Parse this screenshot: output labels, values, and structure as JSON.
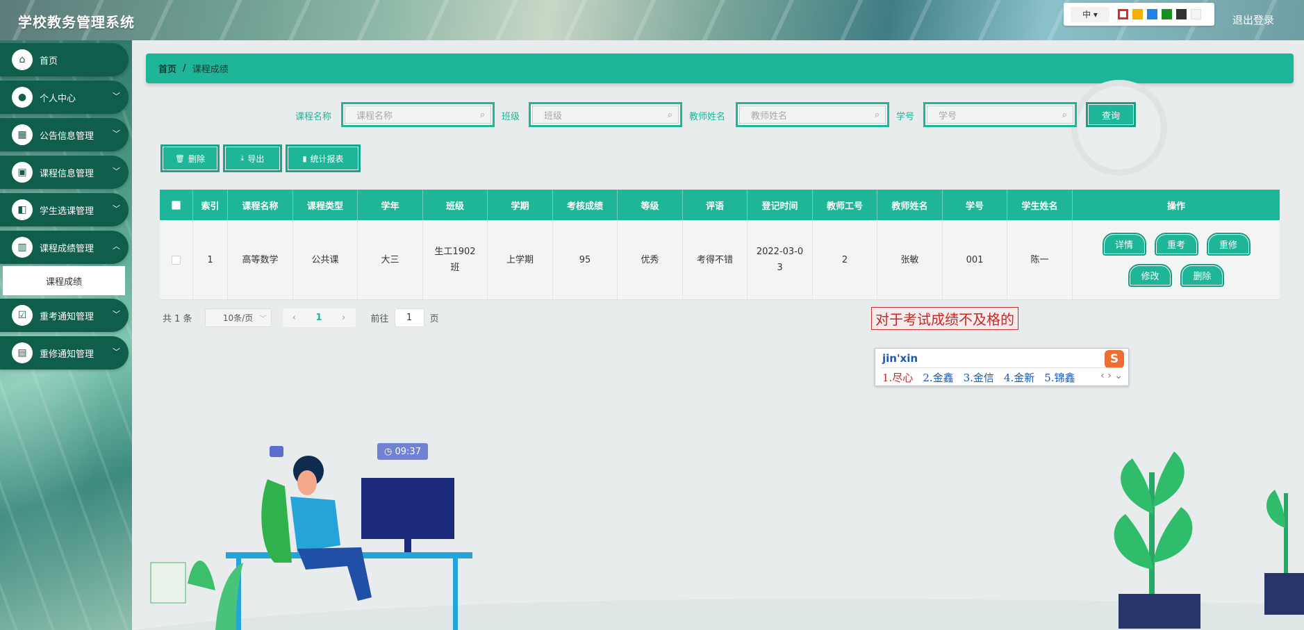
{
  "header": {
    "app_title": "学校教务管理系统",
    "lang": "中",
    "logout": "退出登录",
    "theme_colors": [
      "#e8261f",
      "#f2b100",
      "#1c86e8",
      "#17911d",
      "#333333",
      "#f4f4f4"
    ]
  },
  "sidebar": {
    "items": [
      {
        "label": "首页",
        "icon": "home-icon"
      },
      {
        "label": "个人中心",
        "icon": "user-icon"
      },
      {
        "label": "公告信息管理",
        "icon": "grid-icon"
      },
      {
        "label": "课程信息管理",
        "icon": "briefcase-icon"
      },
      {
        "label": "学生选课管理",
        "icon": "wallet-icon"
      },
      {
        "label": "课程成绩管理",
        "icon": "bars-icon"
      },
      {
        "label": "重考通知管理",
        "icon": "clipboard-check-icon"
      },
      {
        "label": "重修通知管理",
        "icon": "clipboard-icon"
      }
    ],
    "sub_active": "课程成绩"
  },
  "breadcrumb": {
    "home": "首页",
    "sep": "/",
    "current": "课程成绩"
  },
  "search": {
    "course_label": "课程名称",
    "course_placeholder": "课程名称",
    "class_label": "班级",
    "class_placeholder": "班级",
    "teacher_label": "教师姓名",
    "teacher_placeholder": "教师姓名",
    "sid_label": "学号",
    "sid_placeholder": "学号",
    "query": "查询"
  },
  "actions": {
    "delete": "删除",
    "export": "导出",
    "report": "统计报表"
  },
  "table": {
    "headers": [
      "索引",
      "课程名称",
      "课程类型",
      "学年",
      "班级",
      "学期",
      "考核成绩",
      "等级",
      "评语",
      "登记时间",
      "教师工号",
      "教师姓名",
      "学号",
      "学生姓名",
      "操作"
    ],
    "rows": [
      {
        "cells": [
          "1",
          "高等数学",
          "公共课",
          "大三",
          "生工1902班",
          "上学期",
          "95",
          "优秀",
          "考得不错",
          "2022-03-03",
          "2",
          "张敏",
          "001",
          "陈一"
        ],
        "ops": [
          "详情",
          "重考",
          "重修",
          "修改",
          "删除"
        ]
      }
    ]
  },
  "pager": {
    "total": "共 1 条",
    "page_size": "10条/页",
    "current": "1",
    "goto_label": "前往",
    "goto_value": "1",
    "page_suffix": "页"
  },
  "ime": {
    "typed": "对于考试成绩不及格的",
    "composition": "jin'xin",
    "candidates": [
      "1.尽心",
      "2.金鑫",
      "3.金信",
      "4.金新",
      "5.锦鑫"
    ]
  },
  "decor": {
    "time": "09:37"
  }
}
